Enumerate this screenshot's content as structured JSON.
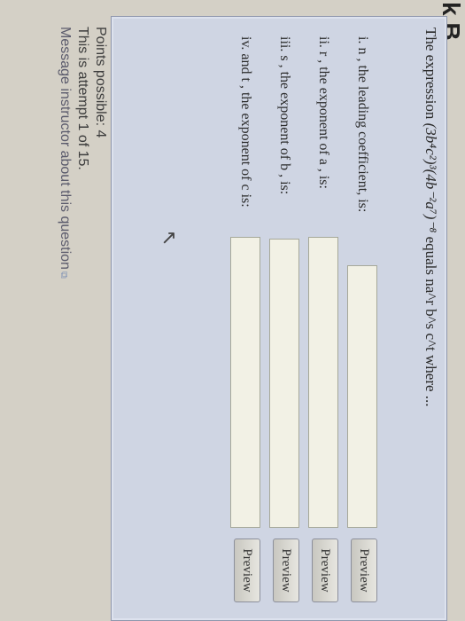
{
  "header": {
    "partial_title": "k B"
  },
  "question": {
    "stem_prefix": "The expression",
    "expression": "(3b⁴c²)³(4b⁻²a⁷)⁻⁸",
    "stem_suffix": "equals na^r b^s c^t where ...",
    "parts": [
      {
        "label": "i. n , the leading coefficient, is:",
        "value": "",
        "preview_label": "Preview"
      },
      {
        "label": "ii. r , the exponent of a , is:",
        "value": "",
        "preview_label": "Preview"
      },
      {
        "label": "iii. s , the exponent of b , is:",
        "value": "",
        "preview_label": "Preview"
      },
      {
        "label": "iv. and t , the exponent of c is:",
        "value": "",
        "preview_label": "Preview"
      }
    ]
  },
  "footer": {
    "points": "Points possible: 4",
    "attempt": "This is attempt 1 of 15.",
    "message_link": "Message instructor about this question"
  },
  "icons": {
    "external_link": "external-link-icon",
    "cursor": "mouse-pointer-icon"
  }
}
